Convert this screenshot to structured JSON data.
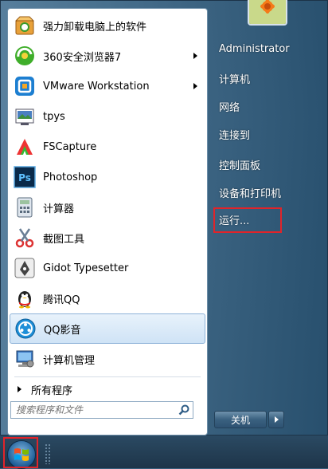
{
  "programs": [
    {
      "label": "强力卸载电脑上的软件",
      "icon": "uninstall-icon",
      "submenu": false
    },
    {
      "label": "360安全浏览器7",
      "icon": "browser-360-icon",
      "submenu": true
    },
    {
      "label": "VMware Workstation",
      "icon": "vmware-icon",
      "submenu": true
    },
    {
      "label": "tpys",
      "icon": "tpys-icon",
      "submenu": false
    },
    {
      "label": "FSCapture",
      "icon": "fscapture-icon",
      "submenu": false
    },
    {
      "label": "Photoshop",
      "icon": "photoshop-icon",
      "submenu": false
    },
    {
      "label": "计算器",
      "icon": "calculator-icon",
      "submenu": false
    },
    {
      "label": "截图工具",
      "icon": "snipping-tool-icon",
      "submenu": false
    },
    {
      "label": "Gidot Typesetter",
      "icon": "gidot-icon",
      "submenu": false
    },
    {
      "label": "腾讯QQ",
      "icon": "qq-penguin-icon",
      "submenu": false
    },
    {
      "label": "QQ影音",
      "icon": "qq-player-icon",
      "submenu": false,
      "highlighted": true
    },
    {
      "label": "计算机管理",
      "icon": "computer-management-icon",
      "submenu": false
    }
  ],
  "photoshop_icon_text": "Ps",
  "all_programs_label": "所有程序",
  "search_placeholder": "搜索程序和文件",
  "right_pane": {
    "user": "Administrator",
    "items": [
      "计算机",
      "网络",
      "连接到",
      "控制面板",
      "设备和打印机",
      "运行..."
    ]
  },
  "shutdown_label": "关机",
  "colors": {
    "highlight_border": "#e0242a",
    "selection": "#cfe3f6"
  }
}
